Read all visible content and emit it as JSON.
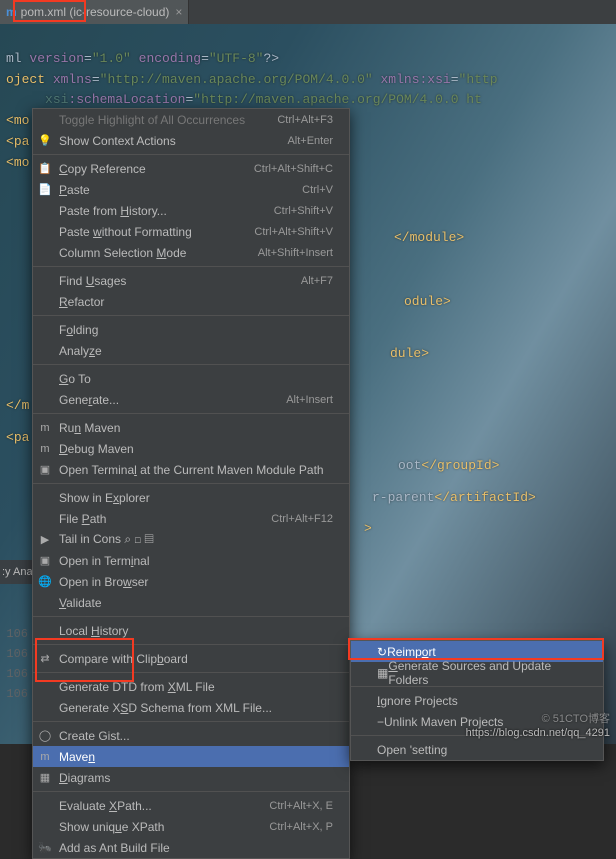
{
  "tab": {
    "icon": "m",
    "title": "pom.xml (ic-resource-cloud)",
    "close": "×"
  },
  "code_l1_a": "ml ",
  "code_l1_b": "version",
  "code_l1_c": "=",
  "code_l1_d": "\"1.0\"",
  "code_l1_e": " encoding",
  "code_l1_f": "\"UTF-8\"",
  "code_l1_g": "?>",
  "code_l2_a": "oject ",
  "code_l2_b": "xmlns",
  "code_l2_c": "=",
  "code_l2_d": "\"http://maven.apache.org/POM/4.0.0\"",
  "code_l2_e": " xmlns:xsi",
  "code_l2_f": "=",
  "code_l2_g": "\"http",
  "code_l3_a": "     ",
  "code_l3_b": "xsi",
  "code_l3_c": ":schemaLocation",
  "code_l3_d": "=",
  "code_l3_e": "\"http://maven.apache.org/POM/4.0.0 ht",
  "code_l4_a": "<",
  "code_l4_b": "mo",
  "code_l5_a": "<",
  "code_l5_b": "pa",
  "code_l6_a": "<",
  "code_l6_b": "mo",
  "code_l7": "</module>",
  "code_l8": "odule>",
  "code_l9": "dule>",
  "code_l10a": "</",
  "code_l10b": "m",
  "code_l11a": "<",
  "code_l11b": "pa",
  "code_l12_a": "oot",
  "code_l12_b": "</groupId>",
  "code_l13_a": "r-parent",
  "code_l13_b": "</artifactId>",
  "code_l14": ">",
  "gutter": [
    "106",
    "106",
    "106",
    "106"
  ],
  "sidetext": ":y Ana",
  "menu": [
    {
      "label_html": "Toggle Highlight of All Occurrences",
      "shortcut": "Ctrl+Alt+F3",
      "dis": true
    },
    {
      "icon": "💡",
      "label_html": "Show Context Actions",
      "shortcut": "Alt+Enter"
    },
    {
      "sep": true
    },
    {
      "icon": "📋",
      "label_html": "<u>C</u>opy Reference",
      "shortcut": "Ctrl+Alt+Shift+C"
    },
    {
      "icon": "📄",
      "label_html": "<u>P</u>aste",
      "shortcut": "Ctrl+V"
    },
    {
      "label_html": "Paste from <u>H</u>istory...",
      "shortcut": "Ctrl+Shift+V"
    },
    {
      "label_html": "Paste <u>w</u>ithout Formatting",
      "shortcut": "Ctrl+Alt+Shift+V"
    },
    {
      "label_html": "Column Selection <u>M</u>ode",
      "shortcut": "Alt+Shift+Insert"
    },
    {
      "sep": true
    },
    {
      "label_html": "Find <u>U</u>sages",
      "shortcut": "Alt+F7"
    },
    {
      "label_html": "<u>R</u>efactor",
      "arrow": true
    },
    {
      "sep": true
    },
    {
      "label_html": "F<u>o</u>lding",
      "arrow": true
    },
    {
      "label_html": "Analy<u>z</u>e",
      "arrow": true
    },
    {
      "sep": true
    },
    {
      "label_html": "<u>G</u>o To",
      "arrow": true
    },
    {
      "label_html": "Gene<u>r</u>ate...",
      "shortcut": "Alt+Insert"
    },
    {
      "sep": true
    },
    {
      "icon": "m",
      "ico_cls": "m-ico",
      "label_html": "Ru<u>n</u> Maven",
      "arrow": true
    },
    {
      "icon": "m",
      "ico_cls": "m-ico",
      "label_html": "<u>D</u>ebug Maven",
      "arrow": true
    },
    {
      "icon": "▣",
      "label_html": "Open Termina<u>l</u> at the Current Maven Module Path"
    },
    {
      "sep": true
    },
    {
      "label_html": "Show in E<u>x</u>plorer"
    },
    {
      "label_html": "File <u>P</u>ath",
      "shortcut": "Ctrl+Alt+F12"
    },
    {
      "icon": "▶",
      "label_html": "Tail in Cons   ⌕  ◻  ▤"
    },
    {
      "icon": "▣",
      "label_html": "Open in Term<u>i</u>nal"
    },
    {
      "icon": "🌐",
      "label_html": "Open in Bro<u>w</u>ser",
      "arrow": true
    },
    {
      "label_html": "<u>V</u>alidate"
    },
    {
      "sep": true
    },
    {
      "label_html": "Local <u>H</u>istory",
      "arrow": true
    },
    {
      "sep": true
    },
    {
      "icon": "⇄",
      "label_html": "Compare with Clip<u>b</u>oard"
    },
    {
      "sep": true
    },
    {
      "label_html": "Generate DTD from <u>X</u>ML File"
    },
    {
      "label_html": "Generate X<u>S</u>D Schema from XML File..."
    },
    {
      "sep": true
    },
    {
      "icon": "◯",
      "label_html": "Create Gist..."
    },
    {
      "icon": "m",
      "ico_cls": "m-ico",
      "label_html": "Mave<u>n</u>",
      "arrow": true,
      "selected": true
    },
    {
      "icon": "▦",
      "label_html": "<u>D</u>iagrams",
      "arrow": true
    },
    {
      "sep": true
    },
    {
      "label_html": "Evaluate <u>X</u>Path...",
      "shortcut": "Ctrl+Alt+X, E"
    },
    {
      "label_html": "Show uniq<u>u</u>e XPath",
      "shortcut": "Ctrl+Alt+X, P"
    },
    {
      "icon": "🐜",
      "label_html": "Add as Ant Build File"
    }
  ],
  "submenu": [
    {
      "icon": "↻",
      "label_html": "Reimp<u>o</u>rt",
      "selected": true
    },
    {
      "icon": "▦",
      "label_html": "<u>G</u>enerate Sources and Update Folders"
    },
    {
      "sep": true
    },
    {
      "label_html": "<u>I</u>gnore Projects"
    },
    {
      "icon": "−",
      "label_html": "Unlink Maven Projects"
    },
    {
      "sep": true
    },
    {
      "label_html": "Open 'setting",
      "trailing": true
    }
  ],
  "watermark1": "© 51CTO博客",
  "watermark2": "https://blog.csdn.net/qq_4291"
}
